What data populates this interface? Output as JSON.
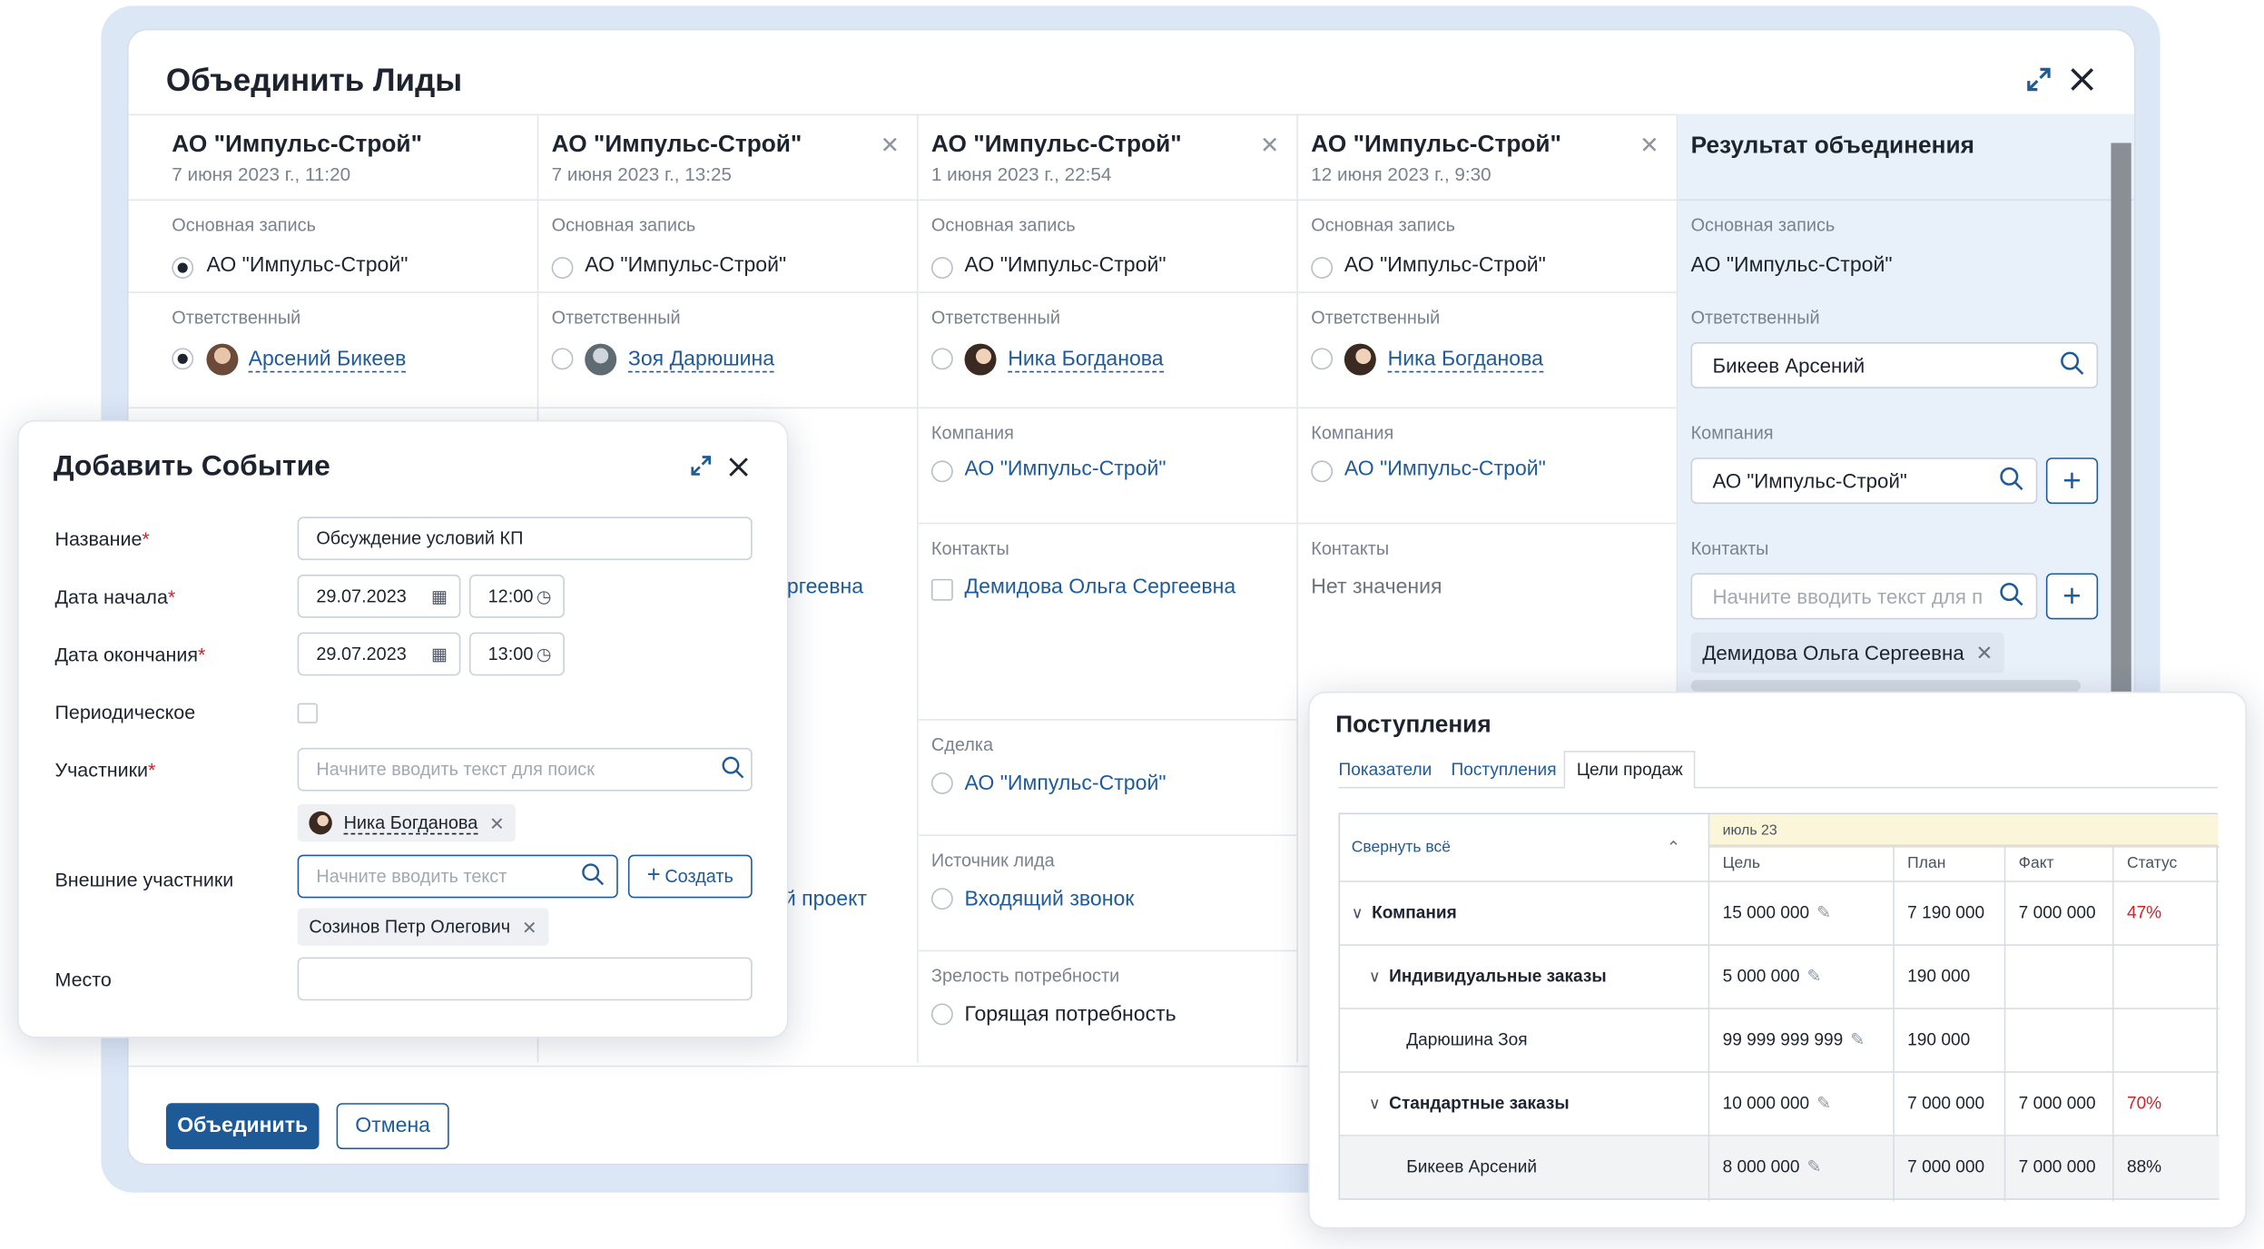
{
  "merge_dialog": {
    "title": "Объединить Лиды",
    "expand_icon": "expand-icon",
    "close_icon": "close-icon",
    "columns": [
      {
        "name": "АО \"Импульс-Строй\"",
        "date": "7 июня 2023 г., 11:20",
        "closable": false,
        "main_record_label": "Основная запись",
        "main_record_value": "АО \"Импульс-Строй\"",
        "main_selected": true,
        "responsible_label": "Ответственный",
        "responsible": "Арсений Бикеев",
        "responsible_selected": true
      },
      {
        "name": "АО \"Импульс-Строй\"",
        "date": "7 июня 2023 г., 13:25",
        "closable": true,
        "main_record_label": "Основная запись",
        "main_record_value": "АО \"Импульс-Строй\"",
        "main_selected": false,
        "responsible_label": "Ответственный",
        "responsible": "Зоя Дарюшина",
        "responsible_selected": false,
        "partial_contact": "ргеевна",
        "partial_source": "ий проект"
      },
      {
        "name": "АО \"Импульс-Строй\"",
        "date": "1 июня 2023 г., 22:54",
        "closable": true,
        "main_record_label": "Основная запись",
        "main_record_value": "АО \"Импульс-Строй\"",
        "responsible_label": "Ответственный",
        "responsible": "Ника Богданова",
        "company_label": "Компания",
        "company": "АО \"Импульс-Строй\"",
        "contacts_label": "Контакты",
        "contact": "Демидова Ольга Сергеевна",
        "deal_label": "Сделка",
        "deal": "АО \"Импульс-Строй\"",
        "source_label": "Источник лида",
        "source": "Входящий звонок",
        "maturity_label": "Зрелость потребности",
        "maturity": "Горящая потребность"
      },
      {
        "name": "АО \"Импульс-Строй\"",
        "date": "12 июня 2023 г., 9:30",
        "closable": true,
        "main_record_label": "Основная запись",
        "main_record_value": "АО \"Импульс-Строй\"",
        "responsible_label": "Ответственный",
        "responsible": "Ника Богданова",
        "company_label": "Компания",
        "company": "АО \"Импульс-Строй\"",
        "contacts_label": "Контакты",
        "contacts_empty": "Нет значения"
      }
    ],
    "result": {
      "title": "Результат объединения",
      "main_record_label": "Основная запись",
      "main_record_value": "АО \"Импульс-Строй\"",
      "responsible_label": "Ответственный",
      "responsible_value": "Бикеев Арсений",
      "company_label": "Компания",
      "company_value": "АО \"Импульс-Строй\"",
      "contacts_label": "Контакты",
      "contacts_placeholder": "Начните вводить текст для п",
      "contact_chip": "Демидова Ольга Сергеевна"
    },
    "merge_button": "Объединить",
    "cancel_button": "Отмена"
  },
  "event_dialog": {
    "title": "Добавить Событие",
    "name_label": "Название",
    "name_value": "Обсуждение условий КП",
    "start_label": "Дата начала",
    "start_date": "29.07.2023",
    "start_time": "12:00",
    "end_label": "Дата окончания",
    "end_date": "29.07.2023",
    "end_time": "13:00",
    "periodic_label": "Периодическое",
    "participants_label": "Участники",
    "participants_placeholder": "Начните вводить текст для поиск",
    "participant_chip": "Ника Богданова",
    "external_label": "Внешние участники",
    "external_placeholder": "Начните вводить текст",
    "create_button": "Создать",
    "external_chip": "Созинов Петр Олегович",
    "place_label": "Место"
  },
  "receipts": {
    "title": "Поступления",
    "tabs": [
      "Показатели",
      "Поступления",
      "Цели продаж"
    ],
    "active_tab": 2,
    "collapse_all": "Свернуть всё",
    "period": "июль 23",
    "headers": [
      "Цель",
      "План",
      "Факт",
      "Статус"
    ],
    "rows": [
      {
        "name": "Компания",
        "level": 0,
        "expandable": true,
        "goal": "15 000 000",
        "plan": "7 190 000",
        "fact": "7 000 000",
        "status": "47%",
        "status_red": true
      },
      {
        "name": "Индивидуальные заказы",
        "level": 1,
        "expandable": true,
        "goal": "5 000 000",
        "plan": "190 000",
        "fact": "",
        "status": "",
        "status_red": false
      },
      {
        "name": "Дарюшина Зоя",
        "level": 2,
        "expandable": false,
        "goal": "99 999 999 999",
        "plan": "190 000",
        "fact": "",
        "status": "",
        "status_red": false
      },
      {
        "name": "Стандартные заказы",
        "level": 1,
        "expandable": true,
        "goal": "10 000 000",
        "plan": "7 000 000",
        "fact": "7 000 000",
        "status": "70%",
        "status_red": true
      },
      {
        "name": "Бикеев Арсений",
        "level": 2,
        "expandable": false,
        "goal": "8 000 000",
        "plan": "7 000 000",
        "fact": "7 000 000",
        "status": "88%",
        "status_red": false
      }
    ]
  },
  "colors": {
    "primary": "#1e5a98",
    "link": "#1f5b9a",
    "result_bg": "#e8f0fa",
    "status_red": "#d2222a",
    "period_bg": "#fbf6d9"
  }
}
